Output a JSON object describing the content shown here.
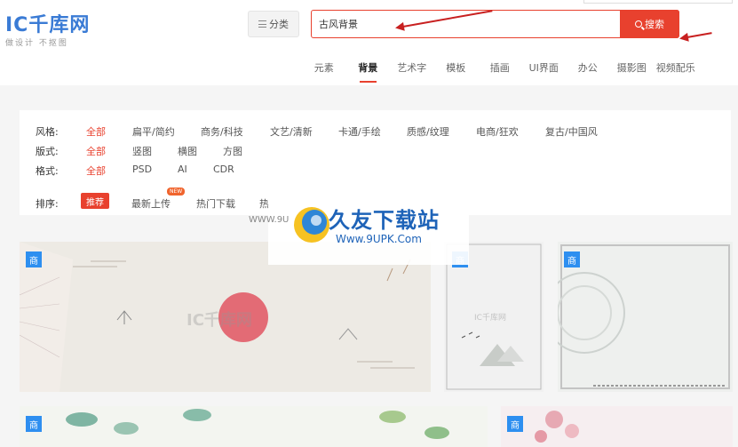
{
  "header": {
    "logo_text": "IC千库网",
    "logo_tagline": "做设计  不抠图",
    "category_label": "分类",
    "search": {
      "value": "古风背景",
      "placeholder": "",
      "button_label": "搜索"
    },
    "nav": [
      {
        "label": "元素",
        "active": false
      },
      {
        "label": "背景",
        "active": true
      },
      {
        "label": "艺术字",
        "active": false
      },
      {
        "label": "模板",
        "active": false
      },
      {
        "label": "插画",
        "active": false
      },
      {
        "label": "UI界面",
        "active": false
      },
      {
        "label": "办公",
        "active": false
      },
      {
        "label": "摄影图",
        "active": false
      },
      {
        "label": "视频配乐",
        "active": false
      }
    ]
  },
  "filters": {
    "style": {
      "label": "风格:",
      "options": [
        "全部",
        "扁平/简约",
        "商务/科技",
        "文艺/清新",
        "卡通/手绘",
        "质感/纹理",
        "电商/狂欢",
        "复古/中国风"
      ]
    },
    "layout": {
      "label": "版式:",
      "options": [
        "全部",
        "竖图",
        "横图",
        "方图"
      ]
    },
    "format": {
      "label": "格式:",
      "options": [
        "全部",
        "PSD",
        "AI",
        "CDR"
      ]
    },
    "sort": {
      "label": "排序:",
      "options": [
        "推荐",
        "最新上传",
        "热门下载",
        "热"
      ],
      "new_badge": "NEW"
    }
  },
  "results": {
    "badge_text": "商",
    "card_watermark": "IC千库网"
  },
  "watermark": {
    "title": "久友下载站",
    "url": "Www.9UPK.Com",
    "prefix": "WWW.9U"
  },
  "colors": {
    "accent": "#e8412e",
    "badge": "#2e8ff0",
    "logo": "#3a7bd5",
    "annotation": "#c82020"
  }
}
